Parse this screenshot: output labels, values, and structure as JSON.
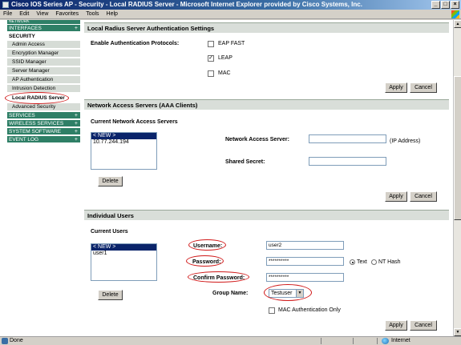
{
  "window": {
    "title": "Cisco IOS Series AP - Security - Local RADIUS Server - Microsoft Internet Explorer provided by Cisco Systems, Inc.",
    "minimize": "_",
    "maximize": "□",
    "close": "×"
  },
  "menu": [
    "File",
    "Edit",
    "View",
    "Favorites",
    "Tools",
    "Help"
  ],
  "nav": {
    "top_partial": "NETWORK",
    "interfaces": "INTERFACES",
    "security": "SECURITY",
    "sub": [
      "Admin Access",
      "Encryption Manager",
      "SSID Manager",
      "Server Manager",
      "AP Authentication",
      "Intrusion Detection",
      "Local RADIUS Server",
      "Advanced Security"
    ],
    "services": "SERVICES",
    "wireless_services": "WIRELESS SERVICES",
    "system_software": "SYSTEM SOFTWARE",
    "event_log": "EVENT LOG",
    "plus": "+"
  },
  "auth_section": {
    "title": "Local Radius Server Authentication Settings",
    "label": "Enable Authentication Protocols:",
    "protocols": [
      {
        "label": "EAP FAST",
        "checked": false
      },
      {
        "label": "LEAP",
        "checked": true
      },
      {
        "label": "MAC",
        "checked": false
      }
    ],
    "check_mark": "✓",
    "apply": "Apply",
    "cancel": "Cancel"
  },
  "nas_section": {
    "title": "Network Access Servers (AAA Clients)",
    "list_label": "Current Network Access Servers",
    "list_items": [
      "< NEW >",
      "10.77.244.194"
    ],
    "delete": "Delete",
    "nas_label": "Network Access Server:",
    "nas_value": "",
    "ip_hint": "(IP Address)",
    "secret_label": "Shared Secret:",
    "secret_value": "",
    "apply": "Apply",
    "cancel": "Cancel"
  },
  "users_section": {
    "title": "Individual Users",
    "list_label": "Current Users",
    "list_items": [
      "< NEW >",
      "user1"
    ],
    "delete": "Delete",
    "username_label": "Username:",
    "username_value": "user2",
    "password_label": "Password:",
    "password_value": "**********",
    "text_option": "Text",
    "nthash_option": "NT Hash",
    "confirm_label": "Confirm Password:",
    "confirm_value": "**********",
    "group_label": "Group Name:",
    "group_value": "Testuser",
    "mac_only_label": "MAC Authentication Only",
    "mac_only_checked": false,
    "apply": "Apply",
    "cancel": "Cancel"
  },
  "status": {
    "text": "Done",
    "zone": "Internet"
  }
}
